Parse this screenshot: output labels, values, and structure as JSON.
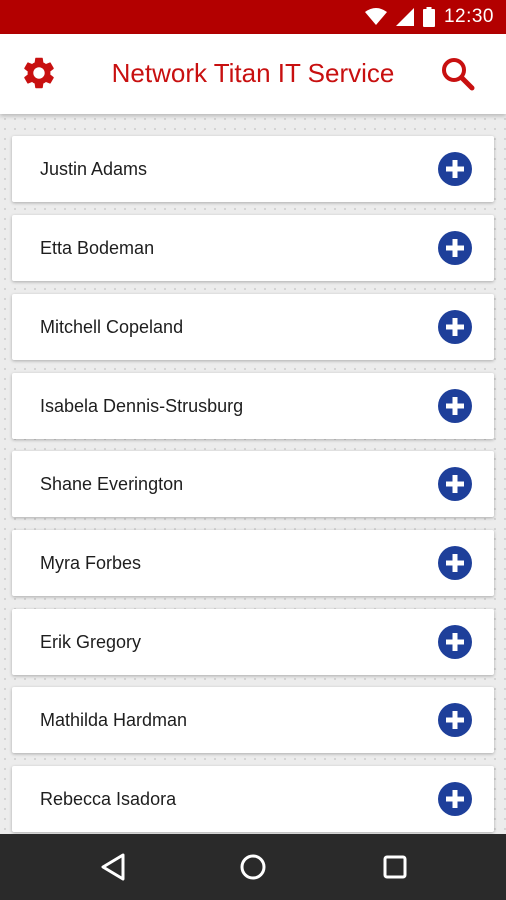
{
  "status_bar": {
    "time": "12:30",
    "icons": [
      "wifi-icon",
      "signal-icon",
      "battery-icon"
    ]
  },
  "app_bar": {
    "title": "Network Titan IT Service",
    "left_icon": "gear-icon",
    "right_icon": "search-icon"
  },
  "contacts": [
    {
      "name": "Justin Adams"
    },
    {
      "name": "Etta Bodeman"
    },
    {
      "name": "Mitchell Copeland"
    },
    {
      "name": "Isabela Dennis-Strusburg"
    },
    {
      "name": "Shane Everington"
    },
    {
      "name": "Myra Forbes"
    },
    {
      "name": "Erik Gregory"
    },
    {
      "name": "Mathilda Hardman"
    },
    {
      "name": "Rebecca Isadora"
    }
  ],
  "nav_bar": {
    "icons": [
      "back-icon",
      "home-icon",
      "recents-icon"
    ]
  },
  "colors": {
    "status_bar": "#b30000",
    "accent_red": "#c81010",
    "add_button_blue": "#1e3f9a",
    "nav_bar": "#2a2a2a"
  }
}
